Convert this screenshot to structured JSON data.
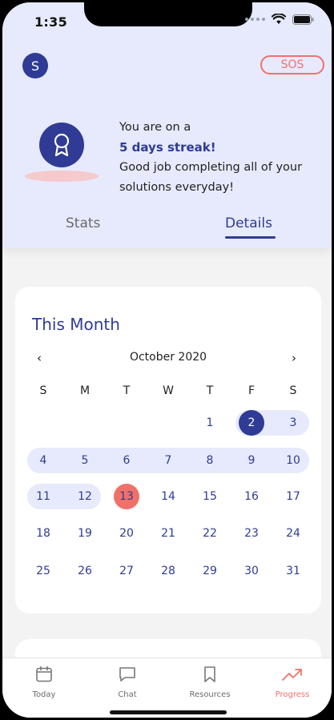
{
  "status_bar": {
    "time": "1:35"
  },
  "header": {
    "avatar_initial": "S",
    "sos_label": "SOS",
    "streak": {
      "line1": "You are on a",
      "highlight": "5 days streak!",
      "line2": "Good job completing all of your",
      "line3": "solutions everyday!"
    },
    "tabs": [
      {
        "label": "Stats",
        "active": false
      },
      {
        "label": "Details",
        "active": true
      }
    ]
  },
  "calendar": {
    "title": "This Month",
    "prev_label": "‹",
    "next_label": "›",
    "month": "October 2020",
    "weekdays": [
      "S",
      "M",
      "T",
      "W",
      "T",
      "F",
      "S"
    ],
    "weeks": [
      [
        "",
        "",
        "",
        "",
        "1",
        "2",
        "3"
      ],
      [
        "4",
        "5",
        "6",
        "7",
        "8",
        "9",
        "10"
      ],
      [
        "11",
        "12",
        "13",
        "14",
        "15",
        "16",
        "17"
      ],
      [
        "18",
        "19",
        "20",
        "21",
        "22",
        "23",
        "24"
      ],
      [
        "25",
        "26",
        "27",
        "28",
        "29",
        "30",
        "31"
      ]
    ],
    "selected_day": "2",
    "today": "13",
    "streak_days": [
      "2",
      "3",
      "4",
      "5",
      "6",
      "7",
      "8",
      "9",
      "10",
      "11",
      "12"
    ]
  },
  "tab_bar": {
    "items": [
      {
        "label": "Today",
        "icon": "calendar-icon",
        "active": false
      },
      {
        "label": "Chat",
        "icon": "chat-bubble-icon",
        "active": false
      },
      {
        "label": "Resources",
        "icon": "bookmark-icon",
        "active": false
      },
      {
        "label": "Progress",
        "icon": "trending-up-icon",
        "active": true
      }
    ]
  },
  "colors": {
    "primary": "#2f3b94",
    "accent": "#f0716a",
    "header_bg": "#e6eafc"
  }
}
